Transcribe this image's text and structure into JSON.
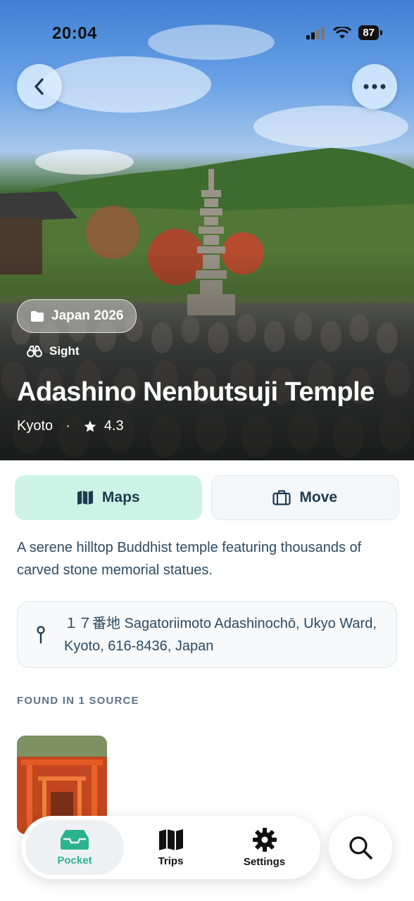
{
  "status_bar": {
    "time": "20:04",
    "battery": "87"
  },
  "hero": {
    "collection_chip": "Japan 2026",
    "category": "Sight",
    "title": "Adashino Nenbutsuji Temple",
    "city": "Kyoto",
    "separator": "·",
    "rating": "4.3"
  },
  "actions": {
    "maps_label": "Maps",
    "move_label": "Move"
  },
  "description": "A serene hilltop Buddhist temple featuring thousands of carved stone memorial statues.",
  "address": "１７番地 Sagatoriimoto Adashinochō, Ukyo Ward, Kyoto, 616-8436, Japan",
  "sources": {
    "heading": "FOUND IN 1 SOURCE"
  },
  "tab_bar": {
    "tabs": [
      {
        "label": "Pocket",
        "icon": "inbox-tray-icon",
        "active": true
      },
      {
        "label": "Trips",
        "icon": "map-icon",
        "active": false
      },
      {
        "label": "Settings",
        "icon": "gear-icon",
        "active": false
      }
    ]
  },
  "colors": {
    "accent": "#2bb38f",
    "maps_button_bg": "#cdf3e6",
    "text_dark": "#1f3347"
  }
}
